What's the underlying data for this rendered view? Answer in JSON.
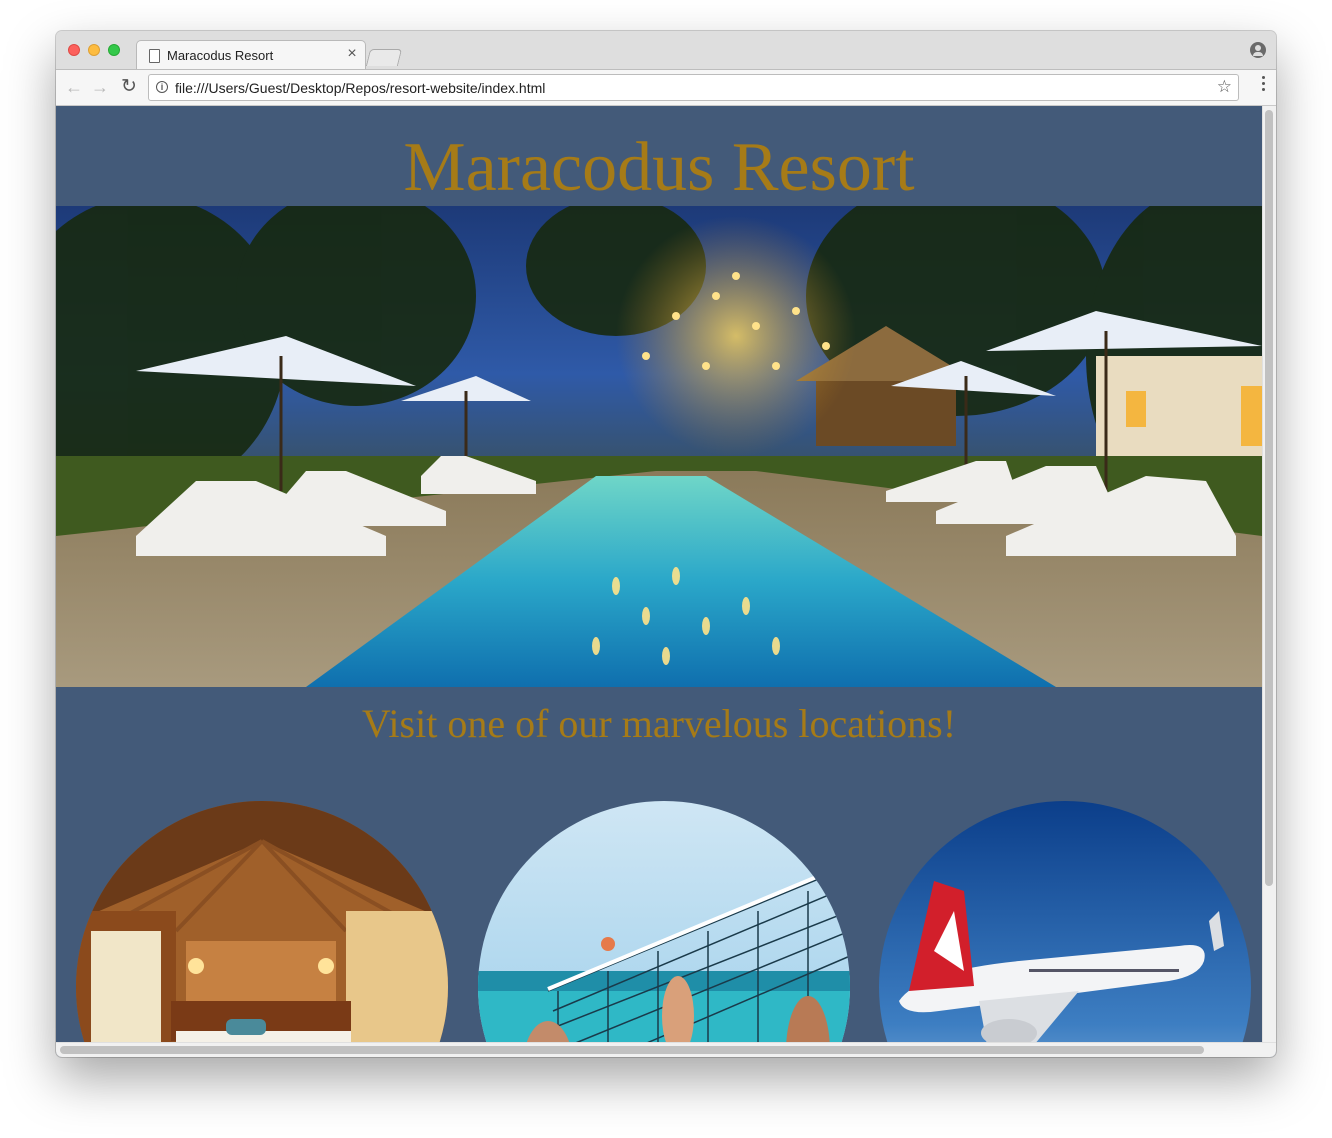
{
  "browser": {
    "tab_title": "Maracodus Resort",
    "tab_close": "×",
    "url": "file:///Users/Guest/Desktop/Repos/resort-website/index.html",
    "back_icon": "arrow-left-icon",
    "forward_icon": "arrow-right-icon",
    "reload_icon": "reload-icon",
    "bookmark_icon": "star-icon"
  },
  "page": {
    "title": "Maracodus Resort",
    "tagline": "Visit one of our marvelous locations!",
    "hero_image": "resort pool at dusk with lounge chairs and umbrellas",
    "locations": [
      {
        "image": "resort bedroom interior"
      },
      {
        "image": "beach volleyball"
      },
      {
        "image": "airplane in sky"
      }
    ]
  },
  "colors": {
    "page_background": "#435a79",
    "heading_gold": "#a67b17"
  }
}
